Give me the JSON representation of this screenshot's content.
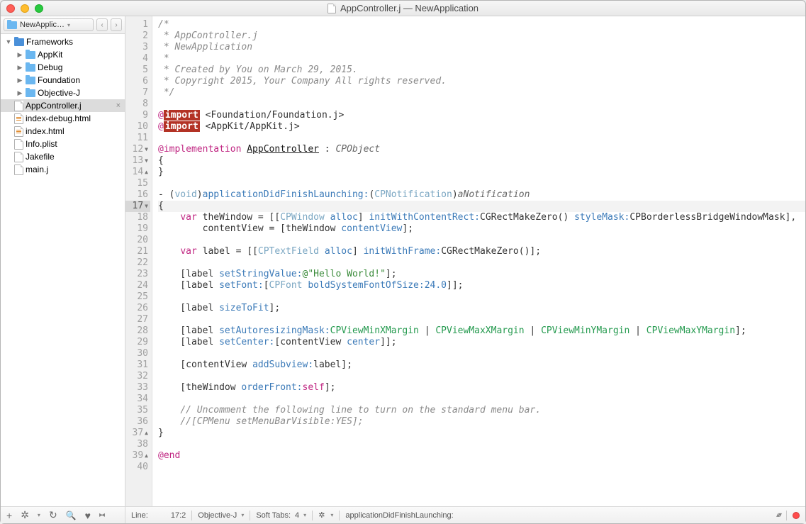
{
  "window": {
    "title": "AppController.j — NewApplication"
  },
  "sidebar": {
    "project": "NewApplic…",
    "tree": [
      {
        "indent": 0,
        "twisty": "▼",
        "icon": "folder-dark",
        "label": "Frameworks"
      },
      {
        "indent": 1,
        "twisty": "▶",
        "icon": "folder",
        "label": "AppKit"
      },
      {
        "indent": 1,
        "twisty": "▶",
        "icon": "folder",
        "label": "Debug"
      },
      {
        "indent": 1,
        "twisty": "▶",
        "icon": "folder",
        "label": "Foundation"
      },
      {
        "indent": 1,
        "twisty": "▶",
        "icon": "folder",
        "label": "Objective-J"
      },
      {
        "indent": 0,
        "twisty": "",
        "icon": "file",
        "label": "AppController.j",
        "selected": true,
        "closable": true
      },
      {
        "indent": 0,
        "twisty": "",
        "icon": "html",
        "label": "index-debug.html"
      },
      {
        "indent": 0,
        "twisty": "",
        "icon": "html",
        "label": "index.html"
      },
      {
        "indent": 0,
        "twisty": "",
        "icon": "file",
        "label": "Info.plist"
      },
      {
        "indent": 0,
        "twisty": "",
        "icon": "file",
        "label": "Jakefile"
      },
      {
        "indent": 0,
        "twisty": "",
        "icon": "file",
        "label": "main.j"
      }
    ]
  },
  "editor": {
    "cursor_line": 17,
    "lines": [
      {
        "n": 1,
        "fold": "",
        "html": "<span class='c-comment'>/*</span>"
      },
      {
        "n": 2,
        "fold": "",
        "html": "<span class='c-comment'> * AppController.j</span>"
      },
      {
        "n": 3,
        "fold": "",
        "html": "<span class='c-comment'> * NewApplication</span>"
      },
      {
        "n": 4,
        "fold": "",
        "html": "<span class='c-comment'> *</span>"
      },
      {
        "n": 5,
        "fold": "",
        "html": "<span class='c-comment'> * Created by You on March 29, 2015.</span>"
      },
      {
        "n": 6,
        "fold": "",
        "html": "<span class='c-comment'> * Copyright 2015, Your Company All rights reserved.</span>"
      },
      {
        "n": 7,
        "fold": "",
        "html": "<span class='c-comment'> */</span>"
      },
      {
        "n": 8,
        "fold": "",
        "html": ""
      },
      {
        "n": 9,
        "fold": "",
        "html": "<span class='c-at'>@</span><span class='c-import'>import</span> &lt;Foundation/Foundation.j&gt;"
      },
      {
        "n": 10,
        "fold": "",
        "html": "<span class='c-at'>@</span><span class='c-import'>import</span> &lt;AppKit/AppKit.j&gt;"
      },
      {
        "n": 11,
        "fold": "",
        "html": ""
      },
      {
        "n": 12,
        "fold": "▼",
        "html": "<span class='c-at'>@implementation</span> <span class='c-cls'>AppController</span> : <span class='c-param'>CPObject</span>"
      },
      {
        "n": 13,
        "fold": "▼",
        "html": "{"
      },
      {
        "n": 14,
        "fold": "▲",
        "html": "}"
      },
      {
        "n": 15,
        "fold": "",
        "html": ""
      },
      {
        "n": 16,
        "fold": "",
        "html": "- (<span class='c-type'>void</span>)<span class='c-func'>applicationDidFinishLaunching:</span>(<span class='c-type'>CPNotification</span>)<span class='c-param'>aNotification</span>"
      },
      {
        "n": 17,
        "fold": "▼",
        "html": "{"
      },
      {
        "n": 18,
        "fold": "",
        "html": "    <span class='c-kw'>var</span> theWindow = [[<span class='c-type'>CPWindow</span> <span class='c-func'>alloc</span>] <span class='c-func'>initWithContentRect:</span>CGRectMakeZero() <span class='c-func'>styleMask:</span>CPBorderlessBridgeWindowMask],"
      },
      {
        "n": 19,
        "fold": "",
        "html": "        contentView = [theWindow <span class='c-func'>contentView</span>];"
      },
      {
        "n": 20,
        "fold": "",
        "html": ""
      },
      {
        "n": 21,
        "fold": "",
        "html": "    <span class='c-kw'>var</span> label = [[<span class='c-type'>CPTextField</span> <span class='c-func'>alloc</span>] <span class='c-func'>initWithFrame:</span>CGRectMakeZero()];"
      },
      {
        "n": 22,
        "fold": "",
        "html": ""
      },
      {
        "n": 23,
        "fold": "",
        "html": "    [label <span class='c-func'>setStringValue:</span><span class='c-str'>@\"Hello World!\"</span>];"
      },
      {
        "n": 24,
        "fold": "",
        "html": "    [label <span class='c-func'>setFont:</span>[<span class='c-type'>CPFont</span> <span class='c-func'>boldSystemFontOfSize:24.0</span>]];"
      },
      {
        "n": 25,
        "fold": "",
        "html": ""
      },
      {
        "n": 26,
        "fold": "",
        "html": "    [label <span class='c-func'>sizeToFit</span>];"
      },
      {
        "n": 27,
        "fold": "",
        "html": ""
      },
      {
        "n": 28,
        "fold": "",
        "html": "    [label <span class='c-func'>setAutoresizingMask:</span><span class='c-const'>CPViewMinXMargin</span> | <span class='c-const'>CPViewMaxXMargin</span> | <span class='c-const'>CPViewMinYMargin</span> | <span class='c-const'>CPViewMaxYMargin</span>];"
      },
      {
        "n": 29,
        "fold": "",
        "html": "    [label <span class='c-func'>setCenter:</span>[contentView <span class='c-func'>center</span>]];"
      },
      {
        "n": 30,
        "fold": "",
        "html": ""
      },
      {
        "n": 31,
        "fold": "",
        "html": "    [contentView <span class='c-func'>addSubview:</span>label];"
      },
      {
        "n": 32,
        "fold": "",
        "html": ""
      },
      {
        "n": 33,
        "fold": "",
        "html": "    [theWindow <span class='c-func'>orderFront:</span><span class='c-kw'>self</span>];"
      },
      {
        "n": 34,
        "fold": "",
        "html": ""
      },
      {
        "n": 35,
        "fold": "",
        "html": "    <span class='c-comment'>// Uncomment the following line to turn on the standard menu bar.</span>"
      },
      {
        "n": 36,
        "fold": "",
        "html": "    <span class='c-comment'>//[CPMenu setMenuBarVisible:YES];</span>"
      },
      {
        "n": 37,
        "fold": "▲",
        "html": "}"
      },
      {
        "n": 38,
        "fold": "",
        "html": ""
      },
      {
        "n": 39,
        "fold": "▲",
        "html": "<span class='c-at'>@end</span>"
      },
      {
        "n": 40,
        "fold": "",
        "html": ""
      }
    ]
  },
  "status": {
    "line_label": "Line:",
    "cursor": "17:2",
    "language": "Objective-J",
    "softtabs_label": "Soft Tabs:",
    "softtabs_value": "4",
    "symbol": "applicationDidFinishLaunching:"
  }
}
